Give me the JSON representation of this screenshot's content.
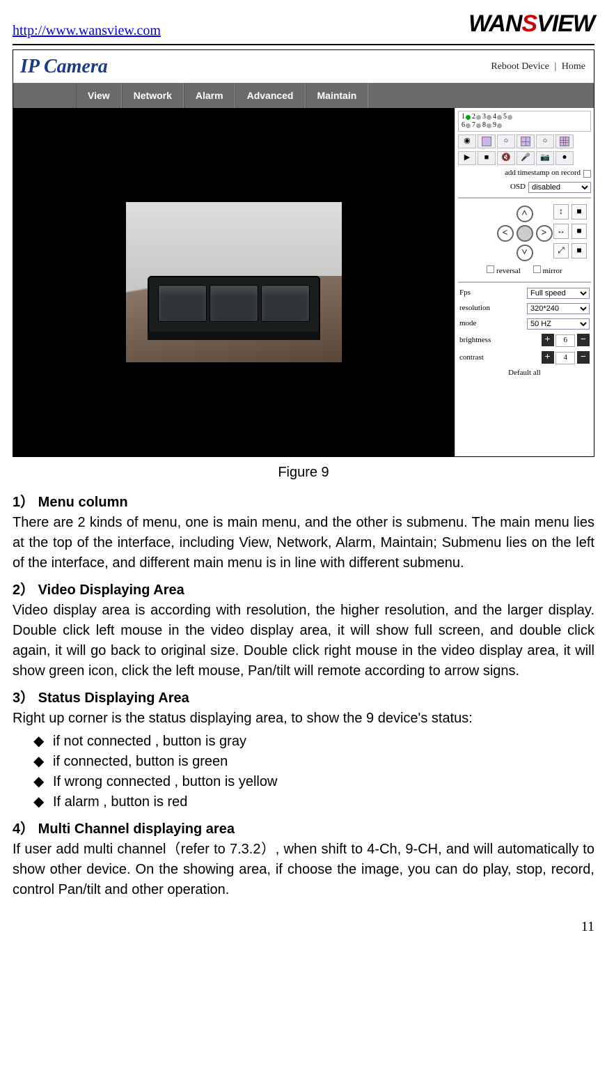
{
  "header": {
    "url": "http://www.wansview.com",
    "brand": {
      "part1": "WAN",
      "s": "S",
      "part2": "VIEW"
    }
  },
  "screenshot": {
    "logo": "IP Camera",
    "top_links": {
      "reboot": "Reboot Device",
      "sep": "|",
      "home": "Home"
    },
    "menu": [
      "View",
      "Network",
      "Alarm",
      "Advanced",
      "Maintain"
    ],
    "channels": [
      "1",
      "2",
      "3",
      "4",
      "5",
      "6",
      "7",
      "8",
      "9"
    ],
    "tools": [
      "▶",
      "■",
      "🔇",
      "🎤",
      "📷",
      "⏺"
    ],
    "timestamp_label": "add timestamp on record",
    "osd": {
      "label": "OSD",
      "value": "disabled"
    },
    "ptz_side": [
      "↕",
      "■",
      "↔",
      "■",
      "⤢",
      "■"
    ],
    "reversal": "reversal",
    "mirror": "mirror",
    "settings": {
      "fps": {
        "label": "Fps",
        "value": "Full speed"
      },
      "resolution": {
        "label": "resolution",
        "value": "320*240"
      },
      "mode": {
        "label": "mode",
        "value": "50 HZ"
      },
      "brightness": {
        "label": "brightness",
        "value": "6"
      },
      "contrast": {
        "label": "contrast",
        "value": "4"
      }
    },
    "default_all": "Default all"
  },
  "caption": "Figure 9",
  "sections": {
    "s1": {
      "title": "1） Menu column",
      "text": "There are 2 kinds of menu, one is main menu, and the other is submenu. The main menu lies at the top of the interface, including View, Network, Alarm, Maintain; Submenu lies on the left of the interface, and different main menu is in line with different submenu."
    },
    "s2": {
      "title": "2） Video Displaying Area",
      "text": "Video display area is according with resolution, the higher resolution, and the larger display. Double click left mouse in the video display area, it will show full screen, and double click again, it will go back to original size. Double click right mouse in the video display area, it will show green icon, click the left mouse, Pan/tilt will remote according to arrow signs."
    },
    "s3": {
      "title": "3） Status Displaying Area",
      "text": "Right up corner is the status displaying area, to show the 9 device's status:",
      "bullets": [
        "if not connected , button is gray",
        "if connected, button is green",
        "If wrong connected , button is yellow",
        "If alarm , button is red"
      ]
    },
    "s4": {
      "title": "4） Multi Channel displaying area",
      "text": "If user add multi channel（refer to 7.3.2）, when shift to 4-Ch, 9-CH, and will automatically to show other device. On the showing area, if choose the image, you can do play, stop, record, control Pan/tilt and other operation."
    }
  },
  "page_number": "11"
}
